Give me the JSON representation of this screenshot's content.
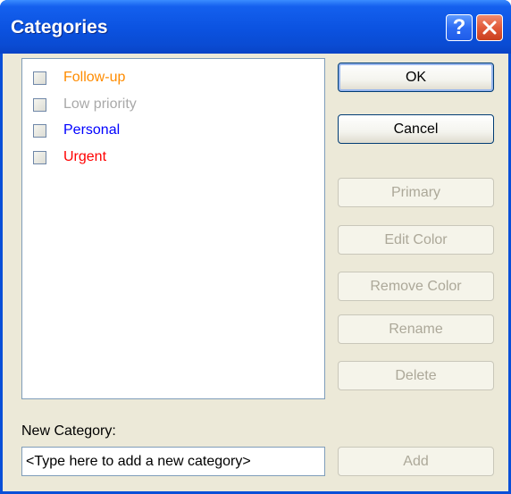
{
  "window": {
    "title": "Categories",
    "help_symbol": "?",
    "close_symbol": "✕"
  },
  "categories": [
    {
      "label": "Follow-up",
      "color": "#ff8c00",
      "checked": false
    },
    {
      "label": "Low priority",
      "color": "#a9a9a9",
      "checked": false
    },
    {
      "label": "Personal",
      "color": "#0000ff",
      "checked": false
    },
    {
      "label": "Urgent",
      "color": "#ff0000",
      "checked": false
    }
  ],
  "buttons": {
    "ok": "OK",
    "cancel": "Cancel",
    "primary": "Primary",
    "edit_color": "Edit Color",
    "remove_color": "Remove Color",
    "rename": "Rename",
    "delete": "Delete",
    "add": "Add"
  },
  "new_category": {
    "label": "New Category:",
    "placeholder": "<Type here to add a new category>"
  }
}
